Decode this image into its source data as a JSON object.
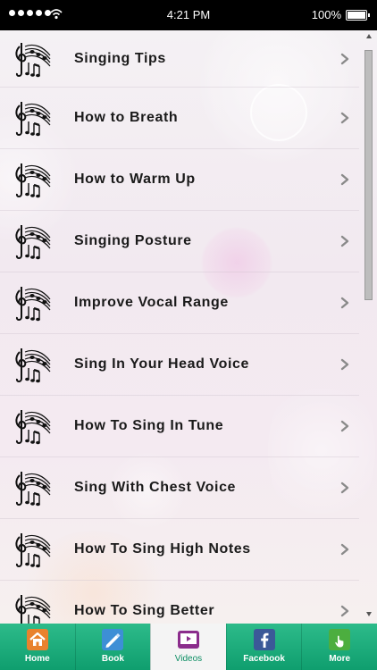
{
  "status_bar": {
    "time": "4:21 PM",
    "battery": "100%"
  },
  "list": {
    "items": [
      {
        "label": "Singing Tips"
      },
      {
        "label": "How to Breath"
      },
      {
        "label": "How to Warm Up"
      },
      {
        "label": "Singing Posture"
      },
      {
        "label": "Improve Vocal Range"
      },
      {
        "label": "Sing In Your Head Voice"
      },
      {
        "label": "How To Sing In Tune"
      },
      {
        "label": "Sing With Chest Voice"
      },
      {
        "label": "How To Sing High Notes"
      },
      {
        "label": "How To Sing Better"
      }
    ],
    "item_icon": "music-notes-icon",
    "chevron_icon": "chevron-right-icon"
  },
  "tabs": {
    "items": [
      {
        "label": "Home",
        "icon": "home-icon",
        "active": false
      },
      {
        "label": "Book",
        "icon": "book-icon",
        "active": false
      },
      {
        "label": "Videos",
        "icon": "video-icon",
        "active": true
      },
      {
        "label": "Facebook",
        "icon": "facebook-icon",
        "active": false
      },
      {
        "label": "More",
        "icon": "more-icon",
        "active": false
      }
    ]
  },
  "colors": {
    "tab_bar": "#1aab7a",
    "active_tab_text": "#0c8e63",
    "list_text": "#1a1a1a",
    "chevron": "#8a8a8a"
  }
}
